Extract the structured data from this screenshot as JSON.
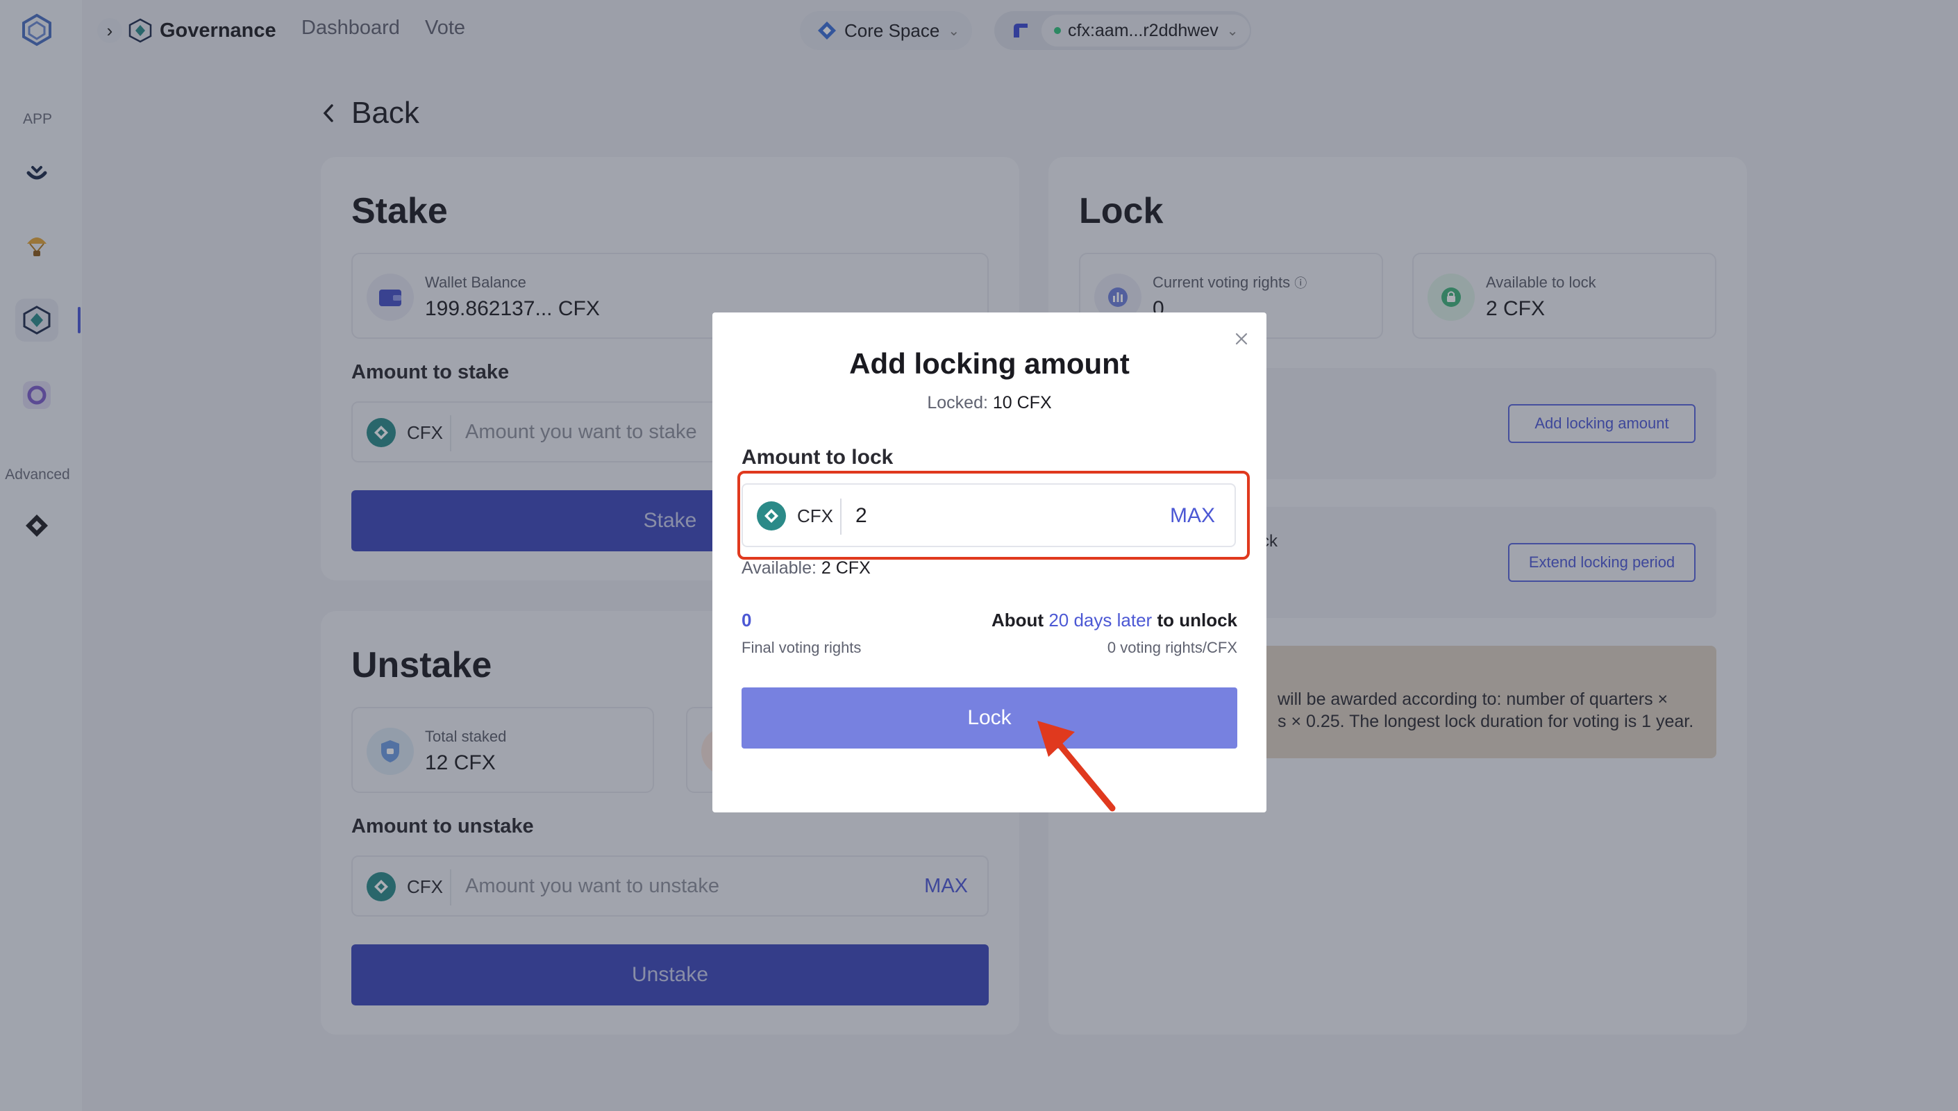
{
  "sidebar": {
    "app_section": "APP",
    "advanced_section": "Advanced"
  },
  "header": {
    "title": "Governance",
    "nav": [
      "Dashboard",
      "Vote"
    ],
    "network": "Core Space",
    "account": "cfx:aam...r2ddhwev"
  },
  "back_label": "Back",
  "stake": {
    "title": "Stake",
    "wallet_label": "Wallet Balance",
    "wallet_value": "199.862137... CFX",
    "amount_label": "Amount to stake",
    "coin": "CFX",
    "placeholder": "Amount you want to stake",
    "button": "Stake"
  },
  "unstake": {
    "title": "Unstake",
    "total_label": "Total staked",
    "total_value": "12 CFX",
    "amount_label": "Amount to unstake",
    "coin": "CFX",
    "placeholder": "Amount you want to unstake",
    "max": "MAX",
    "button": "Unstake"
  },
  "lock": {
    "title": "Lock",
    "voting_label": "Current voting rights",
    "voting_value": "0",
    "available_label": "Available to lock",
    "available_value": "2 CFX",
    "add_button": "Add locking amount",
    "extend_fragment": "ck",
    "extend_button": "Extend locking period",
    "note_line1": "will be awarded according to: number of quarters ×",
    "note_line2": "s × 0.25. The longest lock duration for voting is 1 year."
  },
  "modal": {
    "title": "Add locking amount",
    "locked_label": "Locked:",
    "locked_value": "10 CFX",
    "amount_label": "Amount to lock",
    "coin": "CFX",
    "input_value": "2",
    "max": "MAX",
    "available_label": "Available:",
    "available_value": "2 CFX",
    "voting_value": "0",
    "voting_label": "Final voting rights",
    "unlock_prefix": "About",
    "unlock_highlight": "20 days later",
    "unlock_suffix": "to unlock",
    "rate": "0 voting rights/CFX",
    "lock_button": "Lock"
  },
  "colors": {
    "accent": "#4c58d4",
    "primary_button": "#7781e0",
    "highlight_border": "#e0391e",
    "arrow": "#e0391e"
  }
}
